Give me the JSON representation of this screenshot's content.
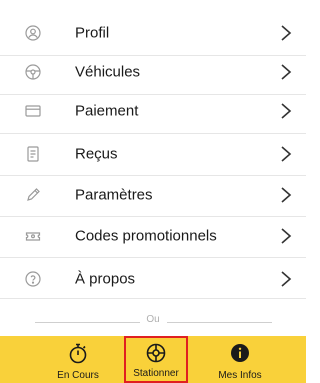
{
  "menu": {
    "items": [
      {
        "label": "Profil",
        "icon": "user-circle-icon"
      },
      {
        "label": "Véhicules",
        "icon": "steering-wheel-icon"
      },
      {
        "label": "Paiement",
        "icon": "credit-card-icon"
      },
      {
        "label": "Reçus",
        "icon": "receipt-icon"
      },
      {
        "label": "Paramètres",
        "icon": "pencil-icon"
      },
      {
        "label": "Codes promotionnels",
        "icon": "ticket-icon"
      },
      {
        "label": "À propos",
        "icon": "question-circle-icon"
      }
    ]
  },
  "separator": {
    "text": "Ou"
  },
  "tabbar": {
    "background": "#f9d13a",
    "tabs": [
      {
        "label": "En Cours",
        "icon": "stopwatch-icon",
        "selected": false
      },
      {
        "label": "Stationner",
        "icon": "parking-wheel-icon",
        "selected": true
      },
      {
        "label": "Mes Infos",
        "icon": "info-circle-icon",
        "selected": false
      }
    ]
  },
  "colors": {
    "selected_outline": "#e02020",
    "icon_gray": "#9a9a9a",
    "divider": "#e6e6e6"
  }
}
